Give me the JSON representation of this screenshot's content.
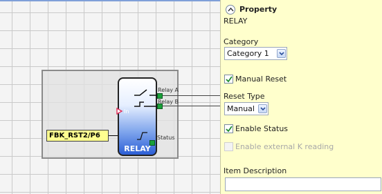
{
  "diagram": {
    "input_tag": "FBK_RST2/P6",
    "block_label": "RELAY",
    "pins": {
      "relay_a": "Relay A",
      "relay_b": "Relay B",
      "in": "In",
      "status": "Status"
    }
  },
  "property_panel": {
    "header": "Property",
    "block_name": "RELAY",
    "category": {
      "label": "Category",
      "value": "Category 1"
    },
    "manual_reset": {
      "label": "Manual Reset",
      "checked": true
    },
    "reset_type": {
      "label": "Reset Type",
      "value": "Manual"
    },
    "enable_status": {
      "label": "Enable Status",
      "checked": true
    },
    "enable_external_k": {
      "label": "Enable external K reading",
      "checked": false,
      "disabled": true
    },
    "item_description": {
      "label": "Item Description",
      "value": ""
    }
  },
  "colors": {
    "panel_bg": "#ffffcc",
    "block_blue": "#2c5fd6",
    "port_green": "#1aa13a",
    "tag_yellow": "#ffff90"
  },
  "icons": [
    "collapse-up-icon",
    "dropdown-arrow-icon",
    "checkmark-icon",
    "contact-switch-icon",
    "pulse-edge-icon",
    "input-arrow-icon"
  ]
}
